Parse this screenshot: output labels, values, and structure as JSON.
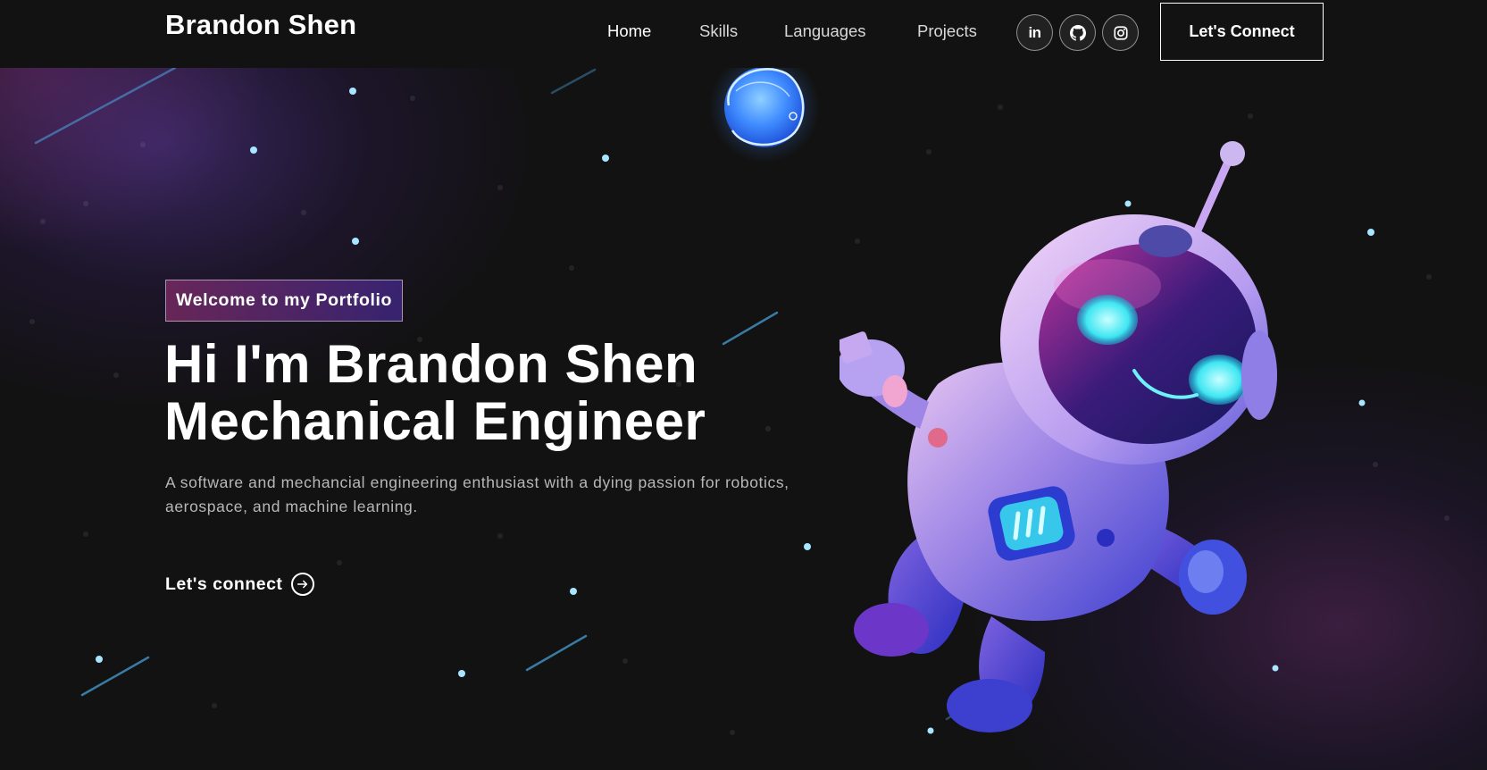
{
  "nav": {
    "brand": "Brandon Shen",
    "links": [
      {
        "label": "Home",
        "active": true
      },
      {
        "label": "Skills",
        "active": false
      },
      {
        "label": "Languages",
        "active": false
      },
      {
        "label": "Projects",
        "active": false
      }
    ],
    "socials": [
      {
        "name": "linkedin-icon",
        "text": "in"
      },
      {
        "name": "github-icon"
      },
      {
        "name": "instagram-icon"
      }
    ],
    "connect_button": "Let's Connect"
  },
  "hero": {
    "tagline": "Welcome to my Portfolio",
    "headline_line1": "Hi I'm Brandon Shen",
    "headline_line2": "Mechanical Engineer",
    "blurb": "A software and mechancial engineering enthusiast with a dying passion for robotics, aerospace, and machine learning.",
    "cta_label": "Let's connect"
  },
  "colors": {
    "background": "#121212",
    "tagline_gradient_start": "#AA367C",
    "tagline_gradient_end": "#4A2FBD",
    "star": "#9fdfff"
  }
}
